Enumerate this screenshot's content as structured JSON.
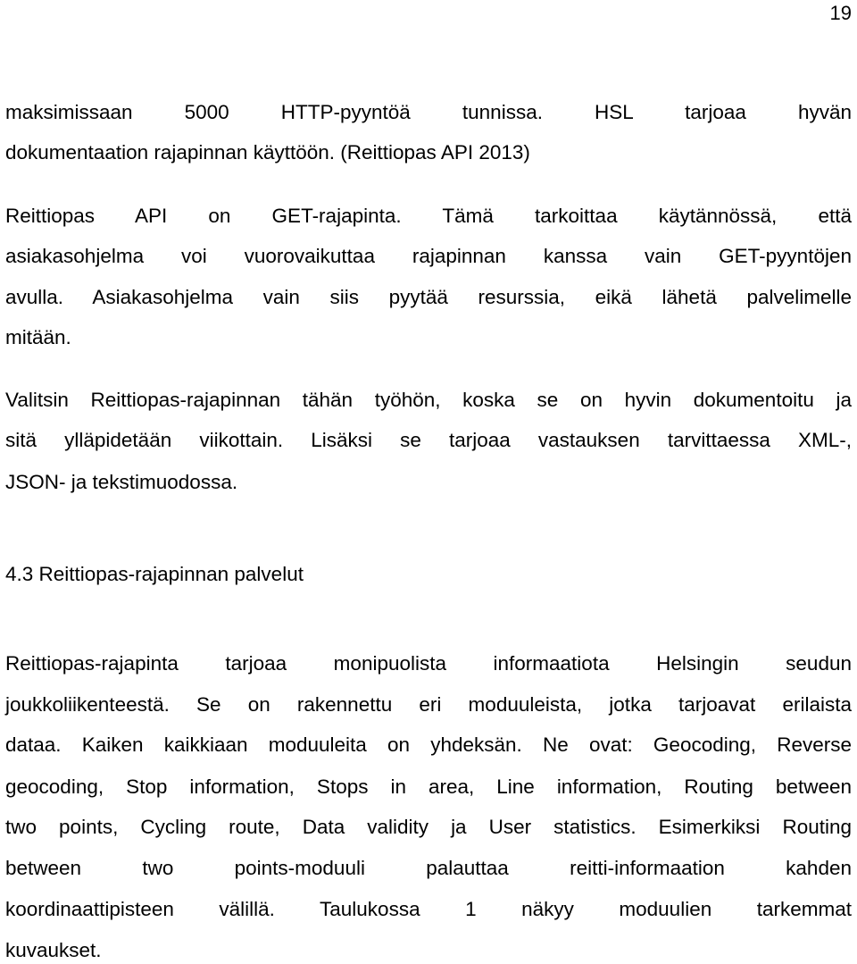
{
  "page_number": "19",
  "paragraphs": [
    {
      "lines": [
        "maksimissaan 5000 HTTP-pyyntöä tunnissa. HSL tarjoaa hyvän",
        "dokumentaation rajapinnan käyttöön. (Reittiopas API 2013)"
      ]
    },
    {
      "lines": [
        "Reittiopas API on GET-rajapinta. Tämä tarkoittaa käytännössä, että",
        "asiakasohjelma voi vuorovaikuttaa rajapinnan kanssa vain GET-pyyntöjen",
        "avulla. Asiakasohjelma vain siis pyytää resurssia, eikä lähetä palvelimelle",
        "mitään."
      ]
    },
    {
      "lines": [
        "Valitsin Reittiopas-rajapinnan tähän työhön, koska se  on hyvin dokumentoitu ja",
        "sitä ylläpidetään viikottain. Lisäksi se tarjoaa vastauksen tarvittaessa XML-,",
        "JSON- ja tekstimuodossa."
      ]
    }
  ],
  "section_heading": "4.3 Reittiopas-rajapinnan palvelut",
  "section_paragraph": {
    "lines": [
      "Reittiopas-rajapinta tarjoaa monipuolista informaatiota Helsingin seudun",
      "joukkoliikenteestä. Se on rakennettu eri moduuleista, jotka tarjoavat erilaista",
      "dataa. Kaiken kaikkiaan moduuleita on yhdeksän. Ne ovat: Geocoding, Reverse",
      "geocoding, Stop information, Stops in area, Line information, Routing between",
      "two points, Cycling route, Data validity ja User statistics. Esimerkiksi Routing",
      "between two points-moduuli palauttaa reitti-informaation kahden",
      "koordinaattipisteen välillä. Taulukossa 1 näkyy moduulien tarkemmat",
      "kuvaukset."
    ]
  }
}
